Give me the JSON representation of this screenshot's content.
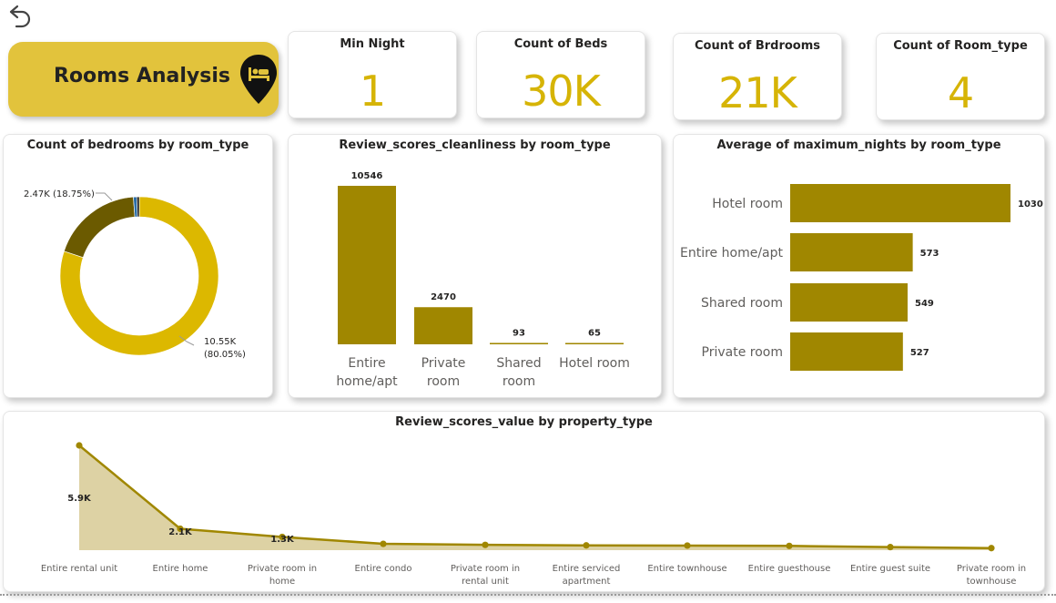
{
  "header": {
    "title": "Rooms Analysis",
    "back_icon": "undo-arrow-icon",
    "title_icon": "bed-location-pin-icon"
  },
  "colors": {
    "gold_dark": "#a08700",
    "gold_bright": "#dcb800",
    "olive_dark": "#6b5a00",
    "area_fill": "#ddd2a4",
    "accent_kpi": "#d6b406",
    "title_bg": "#e2c33c"
  },
  "kpis": [
    {
      "label": "Min Night",
      "value": "1"
    },
    {
      "label": "Count of Beds",
      "value": "30K"
    },
    {
      "label": "Count of Brdrooms",
      "value": "21K"
    },
    {
      "label": "Count of Room_type",
      "value": "4"
    }
  ],
  "panels": {
    "donut_title": "Count of bedrooms by room_type",
    "cleanliness_title": "Review_scores_cleanliness by room_type",
    "maxnights_title": "Average of maximum_nights by room_type",
    "value_title": "Review_scores_value by property_type"
  },
  "chart_data": [
    {
      "type": "pie",
      "title": "Count of bedrooms by room_type",
      "donut": true,
      "slices": [
        {
          "value": 10550,
          "percent": 80.05,
          "label": "10.55K",
          "pct_label": "(80.05%)",
          "color": "#dcb800"
        },
        {
          "value": 2470,
          "percent": 18.75,
          "label": "2.47K (18.75%)",
          "color": "#6b5a00"
        },
        {
          "value": 93,
          "percent": 0.71,
          "label": "",
          "color": "#2b6ea8"
        },
        {
          "value": 65,
          "percent": 0.49,
          "label": "",
          "color": "#1c1c1c"
        }
      ]
    },
    {
      "type": "bar",
      "title": "Review_scores_cleanliness by room_type",
      "categories": [
        "Entire home/apt",
        "Private room",
        "Shared room",
        "Hotel room"
      ],
      "category_lines": [
        [
          "Entire",
          "home/apt"
        ],
        [
          "Private",
          "room"
        ],
        [
          "Shared",
          "room"
        ],
        [
          "Hotel room"
        ]
      ],
      "values": [
        10546,
        2470,
        93,
        65
      ],
      "color": "#a08700"
    },
    {
      "type": "bar",
      "orientation": "horizontal",
      "title": "Average of maximum_nights by room_type",
      "categories": [
        "Hotel room",
        "Entire home/apt",
        "Shared room",
        "Private room"
      ],
      "values": [
        1030,
        573,
        549,
        527
      ],
      "color": "#a08700"
    },
    {
      "type": "area",
      "title": "Review_scores_value by property_type",
      "categories": [
        "Entire rental unit",
        "Entire home",
        "Private room in home",
        "Entire condo",
        "Private room in rental unit",
        "Entire serviced apartment",
        "Entire townhouse",
        "Entire guesthouse",
        "Entire guest suite",
        "Private room in townhouse"
      ],
      "category_lines": [
        [
          "Entire rental unit"
        ],
        [
          "Entire home"
        ],
        [
          "Private room in",
          "home"
        ],
        [
          "Entire condo"
        ],
        [
          "Private room in",
          "rental unit"
        ],
        [
          "Entire serviced",
          "apartment"
        ],
        [
          "Entire townhouse"
        ],
        [
          "Entire guesthouse"
        ],
        [
          "Entire guest suite"
        ],
        [
          "Private room in",
          "townhouse"
        ]
      ],
      "values": [
        10270,
        2100,
        1300,
        620,
        520,
        470,
        450,
        420,
        300,
        200
      ],
      "data_labels": [
        "5.9K",
        "2.1K",
        "1.3K",
        "",
        "",
        "",
        "",
        "",
        "",
        ""
      ],
      "color": "#a08700",
      "fill": "#ddd2a4"
    }
  ]
}
